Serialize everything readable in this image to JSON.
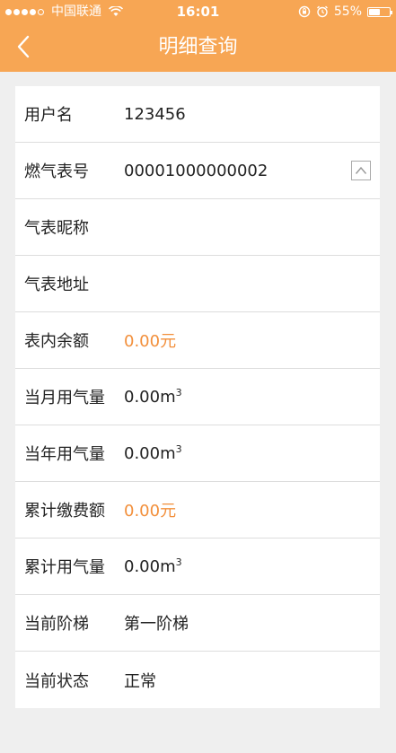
{
  "status_bar": {
    "carrier": "中国联通",
    "time": "16:01",
    "battery_percent": "55%",
    "battery_level": 0.55,
    "signal_bars_filled": 4,
    "signal_bars_total": 5
  },
  "nav": {
    "title": "明细查询",
    "back_icon": "chevron-left-icon"
  },
  "colors": {
    "header_bg": "#f7a654",
    "accent_value": "#f28f3b",
    "page_bg": "#efefef"
  },
  "rows": [
    {
      "label": "用户名",
      "value": "123456"
    },
    {
      "label": "燃气表号",
      "value": "00001000000002",
      "has_expand": true
    },
    {
      "label": "气表昵称",
      "value": ""
    },
    {
      "label": "气表地址",
      "value": ""
    },
    {
      "label": "表内余额",
      "value": "0.00元",
      "highlight": true
    },
    {
      "label": "当月用气量",
      "value": "0.00m",
      "unit_sup": "3"
    },
    {
      "label": "当年用气量",
      "value": "0.00m",
      "unit_sup": "3"
    },
    {
      "label": "累计缴费额",
      "value": "0.00元",
      "highlight": true
    },
    {
      "label": "累计用气量",
      "value": "0.00m",
      "unit_sup": "3"
    },
    {
      "label": "当前阶梯",
      "value": "第一阶梯"
    },
    {
      "label": "当前状态",
      "value": "正常"
    }
  ]
}
